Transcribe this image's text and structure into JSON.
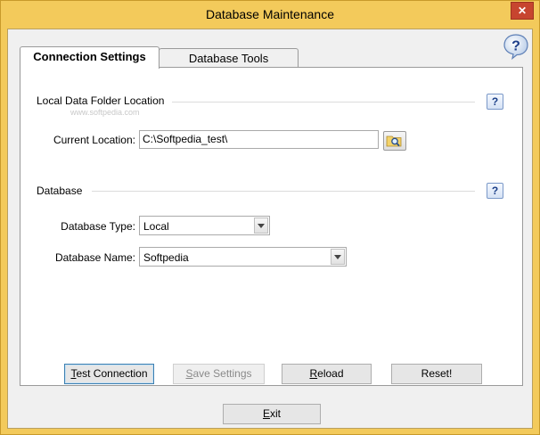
{
  "window": {
    "title": "Database Maintenance",
    "close_glyph": "✕"
  },
  "tabs": [
    {
      "label": "Connection Settings",
      "active": true
    },
    {
      "label": "Database Tools",
      "active": false
    }
  ],
  "help_glyph": "?",
  "watermark": "www.softpedia.com",
  "local_data_folder": {
    "section_label": "Local Data Folder Location",
    "current_location_label": "Current Location:",
    "current_location_value": "C:\\Softpedia_test\\",
    "browse_icon": "folder-search-icon"
  },
  "database": {
    "section_label": "Database",
    "type_label": "Database Type:",
    "type_value": "Local",
    "name_label": "Database Name:",
    "name_value": "Softpedia"
  },
  "buttons": {
    "test_connection": {
      "pre": "",
      "accel": "T",
      "post": "est Connection"
    },
    "save_settings": {
      "pre": "",
      "accel": "S",
      "post": "ave Settings"
    },
    "reload": {
      "pre": "",
      "accel": "R",
      "post": "eload"
    },
    "reset": {
      "label": "Reset!"
    },
    "exit": {
      "pre": "",
      "accel": "E",
      "post": "xit"
    }
  },
  "colors": {
    "title_bar": "#f3ca5b",
    "close_button": "#c7452f",
    "client_background": "#f0f0f0"
  }
}
